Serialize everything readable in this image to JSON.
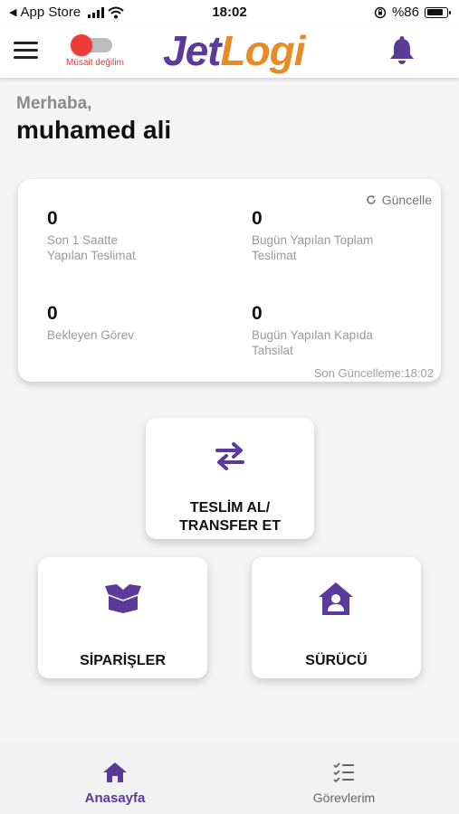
{
  "status_bar": {
    "back_app": "App Store",
    "time": "18:02",
    "battery": "%86",
    "battery_level": 0.86
  },
  "header": {
    "availability_label": "Müsait değilim",
    "logo_part1": "Jet",
    "logo_part2": "Logi",
    "colors": {
      "purple": "#5b3a9a",
      "orange": "#e88a25",
      "toggle_red": "#ef3b35"
    }
  },
  "greeting": {
    "hello": "Merhaba,",
    "name": "muhamed ali"
  },
  "stats": {
    "refresh_label": "Güncelle",
    "items": [
      {
        "value": "0",
        "label_line1": "Son 1 Saatte",
        "label_line2": "Yapılan Teslimat"
      },
      {
        "value": "0",
        "label_line1": "Bugün Yapılan Toplam",
        "label_line2": "Teslimat"
      },
      {
        "value": "0",
        "label_line1": "Bekleyen Görev",
        "label_line2": ""
      },
      {
        "value": "0",
        "label_line1": "Bugün Yapılan Kapıda",
        "label_line2": "Tahsilat"
      }
    ],
    "last_update": "Son Güncelleme:18:02"
  },
  "actions": {
    "transfer_line1": "TESLİM AL/",
    "transfer_line2": "TRANSFER ET",
    "orders": "SİPARİŞLER",
    "driver": "SÜRÜCÜ"
  },
  "bottom_nav": {
    "home": "Anasayfa",
    "tasks": "Görevlerim"
  }
}
